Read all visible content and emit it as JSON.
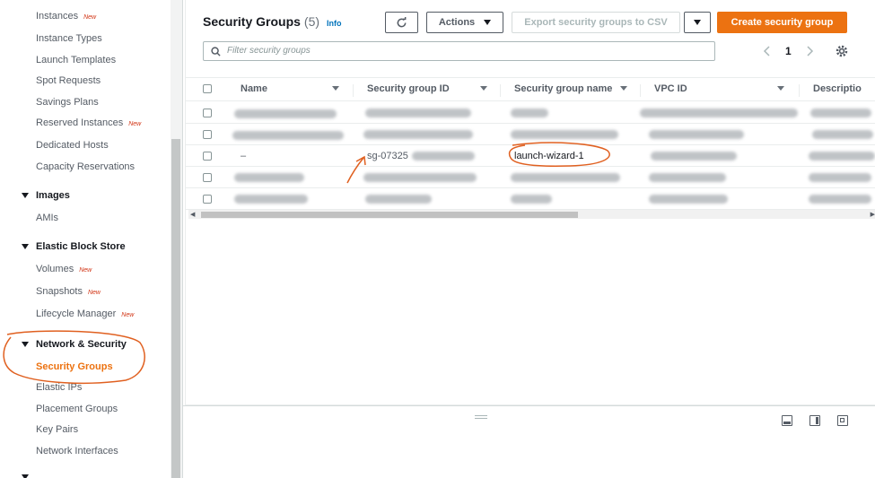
{
  "sidebar": {
    "items": [
      {
        "label": "Instances",
        "new": "New"
      },
      {
        "label": "Instance Types"
      },
      {
        "label": "Launch Templates"
      },
      {
        "label": "Spot Requests"
      },
      {
        "label": "Savings Plans"
      },
      {
        "label": "Reserved Instances",
        "new": "New"
      },
      {
        "label": "Dedicated Hosts"
      },
      {
        "label": "Capacity Reservations"
      }
    ],
    "images_section": "Images",
    "images_items": [
      {
        "label": "AMIs"
      }
    ],
    "ebs_section": "Elastic Block Store",
    "ebs_items": [
      {
        "label": "Volumes",
        "new": "New"
      },
      {
        "label": "Snapshots",
        "new": "New"
      },
      {
        "label": "Lifecycle Manager",
        "new": "New"
      }
    ],
    "network_section": "Network & Security",
    "network_items": [
      {
        "label": "Security Groups",
        "active": true
      },
      {
        "label": "Elastic IPs"
      },
      {
        "label": "Placement Groups"
      },
      {
        "label": "Key Pairs"
      },
      {
        "label": "Network Interfaces"
      }
    ]
  },
  "header": {
    "title": "Security Groups",
    "count": "(5)",
    "info": "Info",
    "actions_label": "Actions",
    "export_label": "Export security groups to CSV",
    "create_label": "Create security group"
  },
  "search": {
    "placeholder": "Filter security groups"
  },
  "pagination": {
    "page": "1"
  },
  "table": {
    "columns": [
      "Name",
      "Security group ID",
      "Security group name",
      "VPC ID",
      "Descriptio"
    ],
    "visible_cells": {
      "row3_name": "–",
      "row3_id": "sg-07325",
      "row3_group_name": "launch-wizard-1"
    }
  },
  "annotations": {
    "color": "#e06020"
  },
  "colors": {
    "accent": "#ec7211",
    "link": "#0073bb"
  }
}
